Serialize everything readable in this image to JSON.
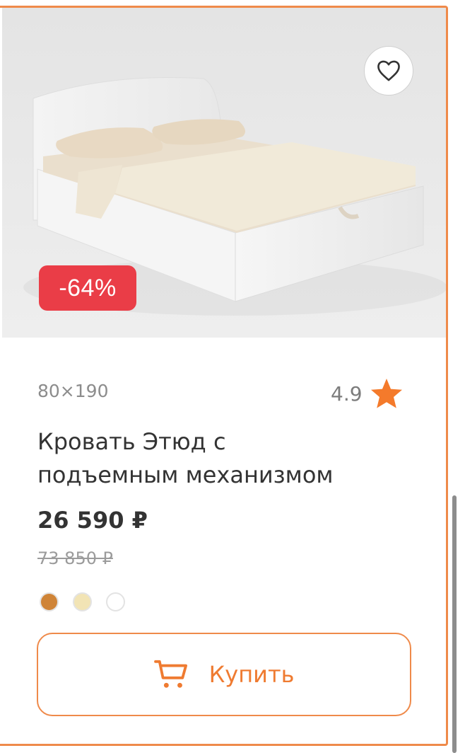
{
  "product": {
    "discount": "-64%",
    "size": "80×190",
    "rating": "4.9",
    "title_line1": "Кровать Этюд с",
    "title_line2": "подъемным механизмом",
    "price": "26 590 ₽",
    "old_price": "73 850 ₽",
    "swatches": [
      "#cf8437",
      "#f2e4b5",
      "#ffffff"
    ],
    "buy_label": "Купить"
  },
  "icons": {
    "favorite": "heart-icon",
    "rating": "star-icon",
    "buy": "cart-icon"
  },
  "colors": {
    "accent": "#ef7b31",
    "border": "#ef8a4a",
    "discount_bg": "#ea3d47",
    "star": "#f47a2b"
  }
}
